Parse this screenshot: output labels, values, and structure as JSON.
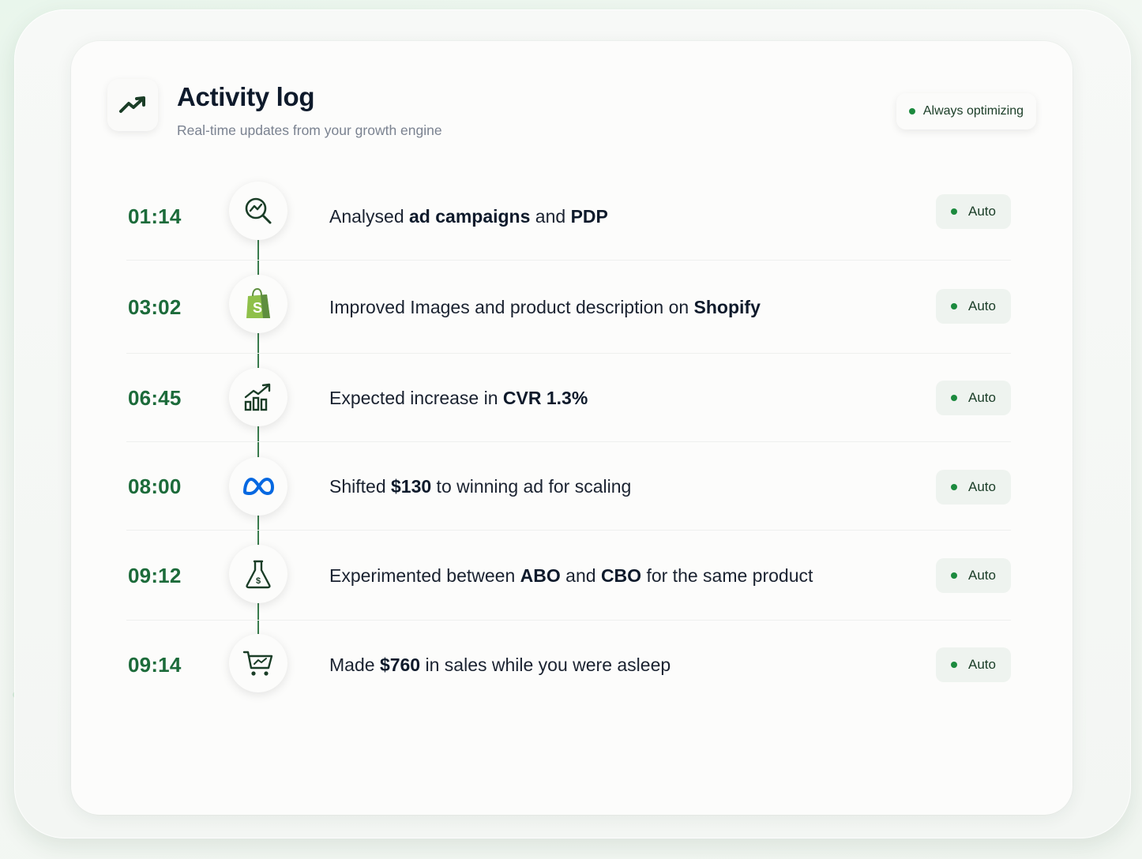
{
  "header": {
    "title": "Activity log",
    "subtitle": "Real-time updates from your growth engine",
    "status": "Always optimizing",
    "icon": "trending-up-icon"
  },
  "colors": {
    "accent": "#1c6b3a",
    "status_dot": "#1c8a3e",
    "title": "#0e1a2b",
    "badge_bg": "#eef3ef"
  },
  "entries": [
    {
      "time": "01:14",
      "icon": "search-analytics-icon",
      "parts": [
        "Analysed ",
        "ad campaigns",
        " and ",
        "PDP",
        ""
      ],
      "badge": "Auto"
    },
    {
      "time": "03:02",
      "icon": "shopify-icon",
      "parts": [
        "Improved Images and product description on ",
        "Shopify",
        "",
        "",
        ""
      ],
      "badge": "Auto"
    },
    {
      "time": "06:45",
      "icon": "bar-chart-growth-icon",
      "parts": [
        "Expected increase in ",
        "CVR 1.3%",
        "",
        "",
        ""
      ],
      "badge": "Auto"
    },
    {
      "time": "08:00",
      "icon": "meta-icon",
      "parts": [
        "Shifted ",
        "$130",
        " to winning ad for scaling",
        "",
        ""
      ],
      "badge": "Auto"
    },
    {
      "time": "09:12",
      "icon": "flask-icon",
      "parts": [
        "Experimented between ",
        "ABO",
        " and ",
        "CBO",
        " for the same product"
      ],
      "badge": "Auto"
    },
    {
      "time": "09:14",
      "icon": "shopping-cart-icon",
      "parts": [
        "Made ",
        "$760",
        " in sales while you were asleep",
        "",
        ""
      ],
      "badge": "Auto"
    }
  ]
}
